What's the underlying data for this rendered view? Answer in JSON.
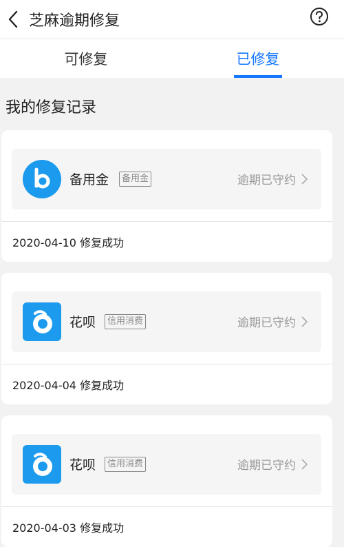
{
  "header": {
    "title": "芝麻逾期修复",
    "back_icon": "chevron-left-icon",
    "help_icon": "question-circle-icon"
  },
  "tabs": [
    {
      "label": "可修复",
      "active": false
    },
    {
      "label": "已修复",
      "active": true
    }
  ],
  "section_title": "我的修复记录",
  "records": [
    {
      "product": "备用金",
      "tag": "备用金",
      "status": "逾期已守约",
      "record": "2020-04-10 修复成功",
      "icon": "beiyongjin-logo-icon"
    },
    {
      "product": "花呗",
      "tag": "信用消费",
      "status": "逾期已守约",
      "record": "2020-04-04 修复成功",
      "icon": "huabei-logo-icon"
    },
    {
      "product": "花呗",
      "tag": "信用消费",
      "status": "逾期已守约",
      "record": "2020-04-03 修复成功",
      "icon": "huabei-logo-icon"
    }
  ],
  "colors": {
    "accent": "#1677ff",
    "logo_blue": "#1c9aed"
  }
}
